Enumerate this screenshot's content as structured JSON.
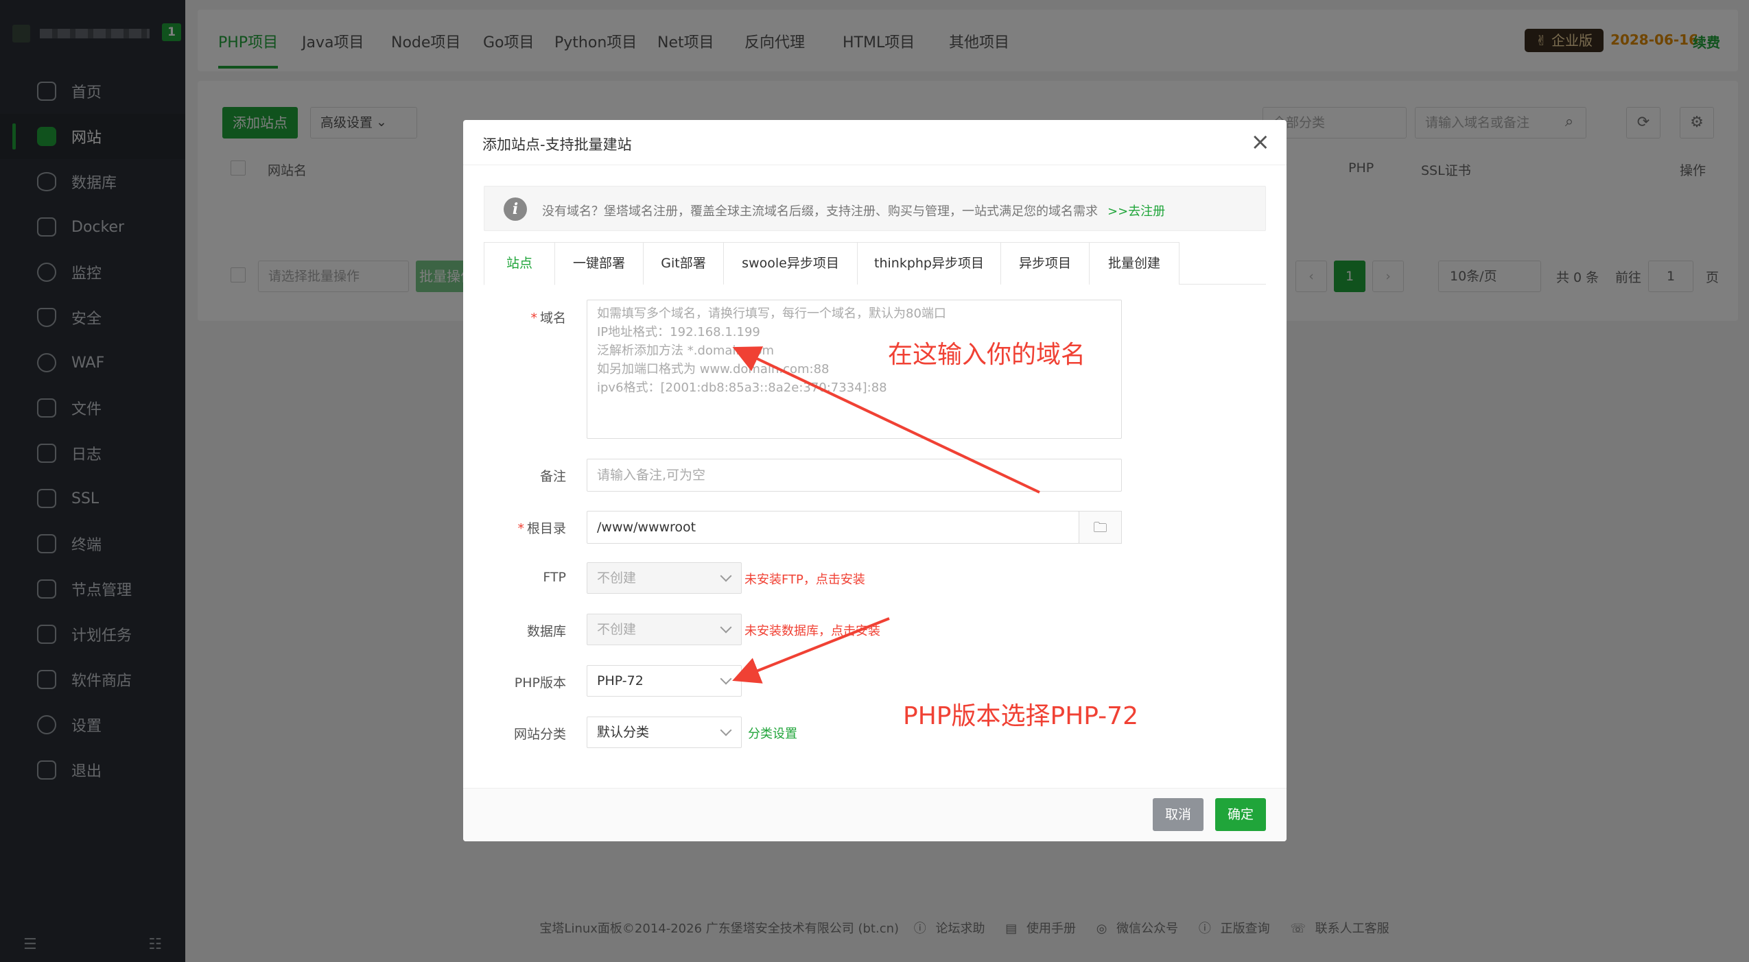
{
  "sidebar": {
    "badge": "1",
    "items": [
      {
        "label": "首页",
        "icon": "home-icon"
      },
      {
        "label": "网站",
        "icon": "website-icon",
        "active": true
      },
      {
        "label": "数据库",
        "icon": "database-icon"
      },
      {
        "label": "Docker",
        "icon": "docker-icon"
      },
      {
        "label": "监控",
        "icon": "monitor-icon"
      },
      {
        "label": "安全",
        "icon": "shield-icon"
      },
      {
        "label": "WAF",
        "icon": "waf-icon"
      },
      {
        "label": "文件",
        "icon": "folder-icon"
      },
      {
        "label": "日志",
        "icon": "log-icon"
      },
      {
        "label": "SSL",
        "icon": "ssl-icon"
      },
      {
        "label": "终端",
        "icon": "terminal-icon"
      },
      {
        "label": "节点管理",
        "icon": "node-icon"
      },
      {
        "label": "计划任务",
        "icon": "calendar-icon"
      },
      {
        "label": "软件商店",
        "icon": "apps-icon"
      },
      {
        "label": "设置",
        "icon": "gear-icon"
      },
      {
        "label": "退出",
        "icon": "logout-icon"
      }
    ]
  },
  "topbar": {
    "tabs": [
      "PHP项目",
      "Java项目",
      "Node项目",
      "Go项目",
      "Python项目",
      "Net项目",
      "反向代理",
      "HTML项目",
      "其他项目"
    ],
    "edition": "企业版",
    "expire_date": "2028-06-16",
    "renew": "续费"
  },
  "toolbar": {
    "add_site": "添加站点",
    "advanced": "高级设置",
    "category_select": "全部分类",
    "search_placeholder": "请输入域名或备注"
  },
  "table": {
    "headers": {
      "name": "网站名",
      "php": "PHP",
      "ssl": "SSL证书",
      "ops": "操作"
    },
    "batch_placeholder": "请选择批量操作",
    "batch_btn": "批量操作"
  },
  "pager": {
    "current": "1",
    "page_size": "10条/页",
    "total": "共 0 条",
    "goto": "前往",
    "goto_value": "1",
    "page_unit": "页"
  },
  "footer": {
    "copyright": "宝塔Linux面板©2014-2026 广东堡塔安全技术有限公司 (bt.cn)",
    "links": [
      "论坛求助",
      "使用手册",
      "微信公众号",
      "正版查询",
      "联系人工客服"
    ]
  },
  "modal": {
    "title": "添加站点-支持批量建站",
    "notice": "没有域名？堡塔域名注册，覆盖全球主流域名后缀，支持注册、购买与管理，一站式满足您的域名需求",
    "notice_link": ">>去注册",
    "tabs": [
      "站点",
      "一键部署",
      "Git部署",
      "swoole异步项目",
      "thinkphp异步项目",
      "异步项目",
      "批量创建"
    ],
    "labels": {
      "domain": "域名",
      "remark": "备注",
      "root": "根目录",
      "ftp": "FTP",
      "database": "数据库",
      "php": "PHP版本",
      "category": "网站分类"
    },
    "domain_placeholder_lines": [
      "如需填写多个域名，请换行填写，每行一个域名，默认为80端口",
      "IP地址格式：192.168.1.199",
      "泛解析添加方法 *.domain.com",
      "如另加端口格式为 www.domain.com:88",
      "ipv6格式：[2001:db8:85a3::8a2e:370:7334]:88"
    ],
    "remark_placeholder": "请输入备注,可为空",
    "root_value": "/www/wwwroot",
    "ftp_value": "不创建",
    "ftp_warning": "未安装FTP，点击安装",
    "db_value": "不创建",
    "db_warning": "未安装数据库，点击安装",
    "php_value": "PHP-72",
    "category_value": "默认分类",
    "category_link": "分类设置",
    "cancel": "取消",
    "confirm": "确定"
  },
  "annotations": {
    "domain_hint": "在这输入你的域名",
    "php_hint": "PHP版本选择PHP-72",
    "color": "#f04134"
  }
}
